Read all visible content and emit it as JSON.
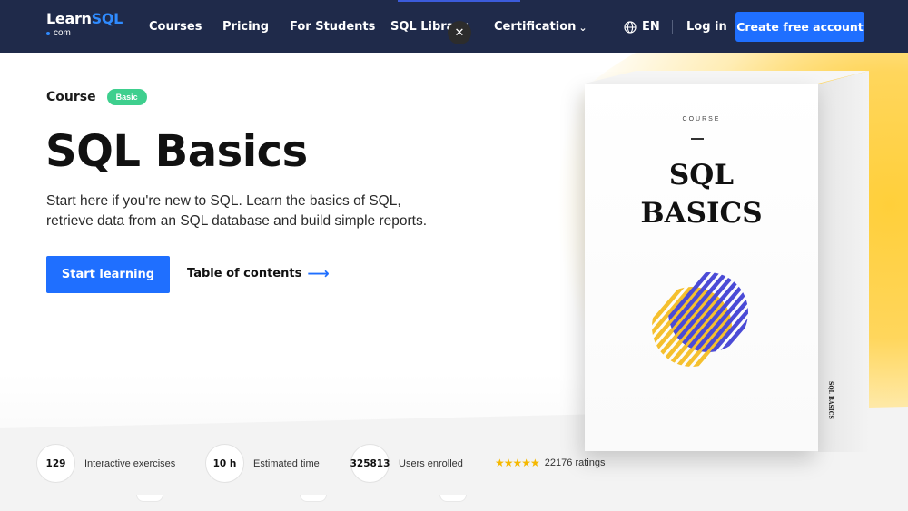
{
  "logo": {
    "main_a": "Learn",
    "main_b": "SQL",
    "sub": "com"
  },
  "nav": {
    "items": [
      "Courses",
      "Pricing",
      "For Students",
      "SQL Library",
      "Certification"
    ],
    "language": "EN",
    "login": "Log in",
    "cta": "Create free account"
  },
  "hero": {
    "course_label": "Course",
    "badge": "Basic",
    "title": "SQL Basics",
    "description": "Start here if you're new to SQL. Learn the basics of SQL, retrieve data from an SQL database and build simple reports.",
    "start_button": "Start learning",
    "toc_link": "Table of contents"
  },
  "box": {
    "course_text": "COURSE",
    "title_line1": "SQL",
    "title_line2": "BASICS",
    "side_text": "SQL BASICS"
  },
  "stats": [
    {
      "value": "129",
      "label": "Interactive exercises"
    },
    {
      "value": "10 h",
      "label": "Estimated time"
    },
    {
      "value": "325813",
      "label": "Users enrolled"
    }
  ],
  "rating": {
    "stars": 5,
    "text": "22176 ratings"
  },
  "colors": {
    "nav_bg": "#1f2a4a",
    "accent": "#1f6fff",
    "badge": "#3ecf8e",
    "glow": "#ffcf3a",
    "art_blue": "#4b4bd6",
    "art_yellow": "#f5c02e"
  }
}
